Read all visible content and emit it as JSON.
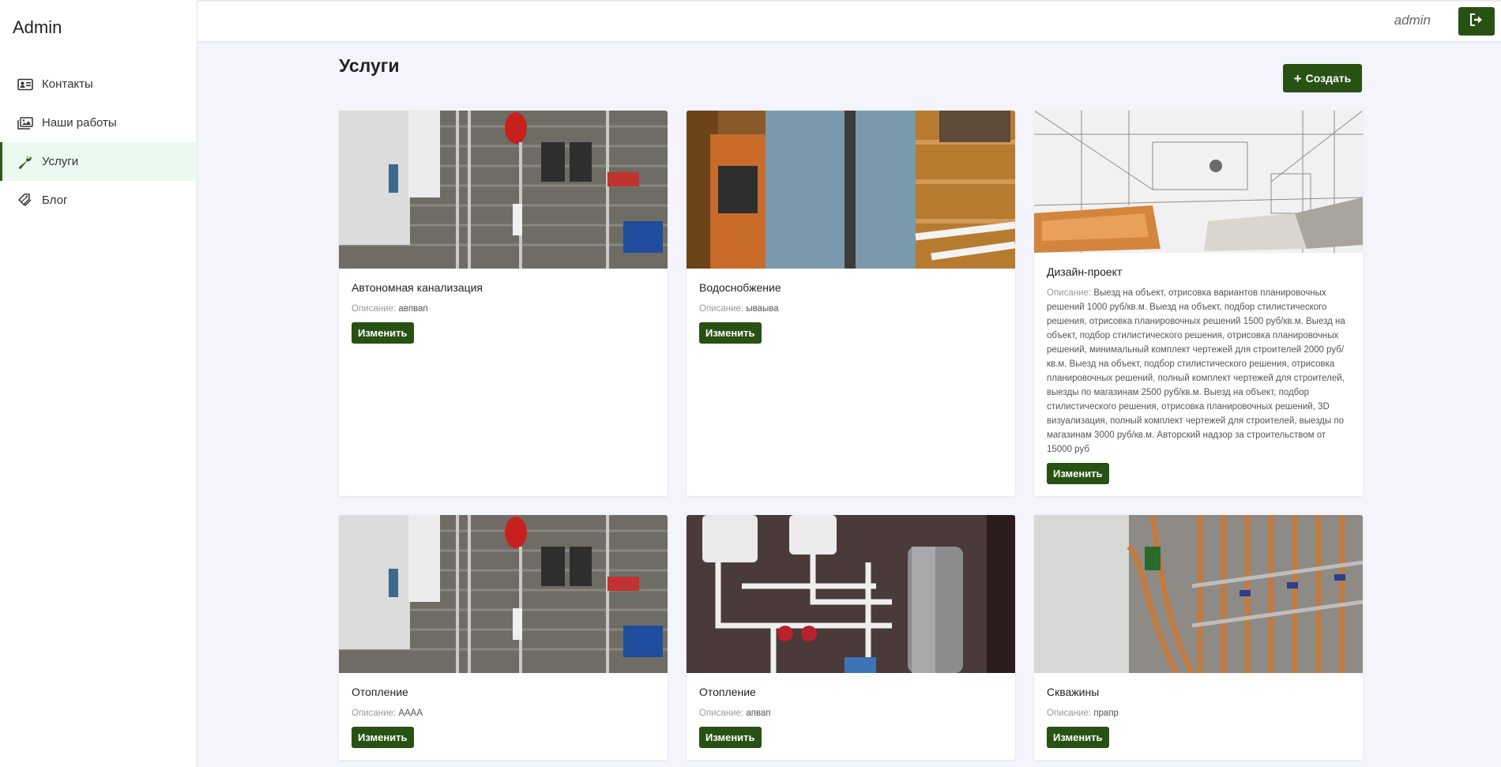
{
  "app": {
    "brand": "Admin"
  },
  "sidebar": {
    "items": [
      {
        "label": "Контакты",
        "icon": "contact-card-icon",
        "active": false
      },
      {
        "label": "Наши работы",
        "icon": "images-icon",
        "active": false
      },
      {
        "label": "Услуги",
        "icon": "wrench-icon",
        "active": true
      },
      {
        "label": "Блог",
        "icon": "tags-icon",
        "active": false
      }
    ]
  },
  "topbar": {
    "user": "admin",
    "logout_icon": "sign-out-icon"
  },
  "page": {
    "title": "Услуги",
    "create_label": "Создать",
    "create_icon": "plus-icon"
  },
  "colors": {
    "accent": "#285214",
    "active_bg": "#eafaf1",
    "background": "#f4f5fc"
  },
  "cards": [
    {
      "title": "Автономная канализация",
      "desc_label": "Описание:",
      "desc": "авпвап",
      "edit_label": "Изменить"
    },
    {
      "title": "Водоснобжение",
      "desc_label": "Описание:",
      "desc": "ываыва",
      "edit_label": "Изменить"
    },
    {
      "title": "Дизайн-проект",
      "desc_label": "Описание:",
      "desc": "Выезд на объект, отрисовка вариантов планировочных решений 1000 руб/кв.м. Выезд на объект, подбор стилистического решения, отрисовка планировочных решений 1500 руб/кв.м. Выезд на объект, подбор стилистического решения, отрисовка планировочных решений, минимальный комплект чертежей для строителей 2000 руб/кв.м. Выезд на объект, подбор стилистического решения, отрисовка планировочных решений, полный комплект чертежей для строителей, выезды по магазинам 2500 руб/кв.м. Выезд на объект, подбор стилистического решения, отрисовка планировочных решений, 3D визуализация, полный комплект чертежей для строителей, выезды по магазинам 3000 руб/кв.м. Авторский надзор за строительством от 15000 руб",
      "edit_label": "Изменить"
    },
    {
      "title": "Отопление",
      "desc_label": "Описание:",
      "desc": "АААА",
      "edit_label": "Изменить"
    },
    {
      "title": "Отопление",
      "desc_label": "Описание:",
      "desc": "апвап",
      "edit_label": "Изменить"
    },
    {
      "title": "Скважины",
      "desc_label": "Описание:",
      "desc": "прапр",
      "edit_label": "Изменить"
    }
  ]
}
